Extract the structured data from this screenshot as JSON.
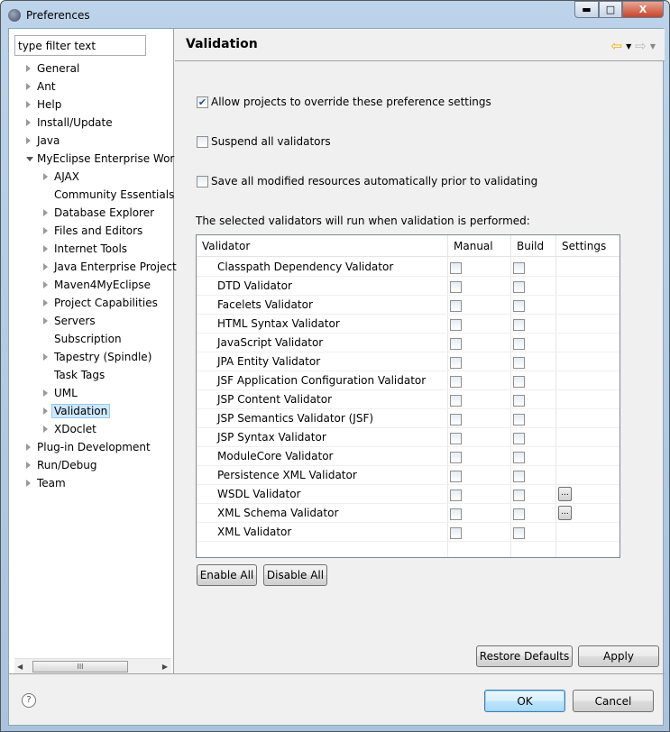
{
  "window": {
    "title": "Preferences",
    "icon": "eclipse-icon",
    "controls": [
      "minimize",
      "maximize",
      "close"
    ]
  },
  "filter": {
    "placeholder": "type filter text",
    "value": "type filter text"
  },
  "tree": [
    {
      "label": "General",
      "level": 0,
      "expander": "collapsed"
    },
    {
      "label": "Ant",
      "level": 0,
      "expander": "collapsed"
    },
    {
      "label": "Help",
      "level": 0,
      "expander": "collapsed"
    },
    {
      "label": "Install/Update",
      "level": 0,
      "expander": "collapsed"
    },
    {
      "label": "Java",
      "level": 0,
      "expander": "collapsed"
    },
    {
      "label": "MyEclipse Enterprise Wor",
      "level": 0,
      "expander": "expanded"
    },
    {
      "label": "AJAX",
      "level": 1,
      "expander": "collapsed"
    },
    {
      "label": "Community Essentials",
      "level": 1,
      "expander": "none"
    },
    {
      "label": "Database Explorer",
      "level": 1,
      "expander": "collapsed"
    },
    {
      "label": "Files and Editors",
      "level": 1,
      "expander": "collapsed"
    },
    {
      "label": "Internet Tools",
      "level": 1,
      "expander": "collapsed"
    },
    {
      "label": "Java Enterprise Project",
      "level": 1,
      "expander": "collapsed"
    },
    {
      "label": "Maven4MyEclipse",
      "level": 1,
      "expander": "collapsed"
    },
    {
      "label": "Project Capabilities",
      "level": 1,
      "expander": "collapsed"
    },
    {
      "label": "Servers",
      "level": 1,
      "expander": "collapsed"
    },
    {
      "label": "Subscription",
      "level": 1,
      "expander": "none"
    },
    {
      "label": "Tapestry (Spindle)",
      "level": 1,
      "expander": "collapsed"
    },
    {
      "label": "Task Tags",
      "level": 1,
      "expander": "none"
    },
    {
      "label": "UML",
      "level": 1,
      "expander": "collapsed"
    },
    {
      "label": "Validation",
      "level": 1,
      "expander": "collapsed",
      "selected": true
    },
    {
      "label": "XDoclet",
      "level": 1,
      "expander": "collapsed"
    },
    {
      "label": "Plug-in Development",
      "level": 0,
      "expander": "collapsed"
    },
    {
      "label": "Run/Debug",
      "level": 0,
      "expander": "collapsed"
    },
    {
      "label": "Team",
      "level": 0,
      "expander": "collapsed"
    }
  ],
  "page": {
    "title": "Validation",
    "options": [
      {
        "label": "Allow projects to override these preference settings",
        "checked": true
      },
      {
        "label": "Suspend all validators",
        "checked": false
      },
      {
        "label": "Save all modified resources automatically prior to validating",
        "checked": false
      }
    ],
    "description": "The selected validators will run when validation is performed:",
    "columns": [
      "Validator",
      "Manual",
      "Build",
      "Settings"
    ],
    "validators": [
      {
        "name": "Classpath Dependency Validator",
        "manual": false,
        "build": false,
        "settings": ""
      },
      {
        "name": "DTD Validator",
        "manual": false,
        "build": false,
        "settings": ""
      },
      {
        "name": "Facelets Validator",
        "manual": false,
        "build": false,
        "settings": ""
      },
      {
        "name": "HTML Syntax Validator",
        "manual": false,
        "build": false,
        "settings": ""
      },
      {
        "name": "JavaScript Validator",
        "manual": false,
        "build": false,
        "settings": ""
      },
      {
        "name": "JPA Entity Validator",
        "manual": false,
        "build": false,
        "settings": ""
      },
      {
        "name": "JSF Application Configuration Validator",
        "manual": false,
        "build": false,
        "settings": ""
      },
      {
        "name": "JSP Content Validator",
        "manual": false,
        "build": false,
        "settings": ""
      },
      {
        "name": "JSP Semantics Validator (JSF)",
        "manual": false,
        "build": false,
        "settings": ""
      },
      {
        "name": "JSP Syntax Validator",
        "manual": false,
        "build": false,
        "settings": ""
      },
      {
        "name": "ModuleCore Validator",
        "manual": false,
        "build": false,
        "settings": ""
      },
      {
        "name": "Persistence XML Validator",
        "manual": false,
        "build": false,
        "settings": ""
      },
      {
        "name": "WSDL Validator",
        "manual": false,
        "build": false,
        "settings": "..."
      },
      {
        "name": "XML Schema Validator",
        "manual": false,
        "build": false,
        "settings": "..."
      },
      {
        "name": "XML Validator",
        "manual": false,
        "build": false,
        "settings": ""
      }
    ],
    "enable_all": "Enable All",
    "disable_all": "Disable All",
    "restore_defaults": "Restore Defaults",
    "apply": "Apply"
  },
  "footer": {
    "ok": "OK",
    "cancel": "Cancel",
    "help_icon": "help-icon"
  },
  "scrollbar": {
    "grip": "III"
  }
}
